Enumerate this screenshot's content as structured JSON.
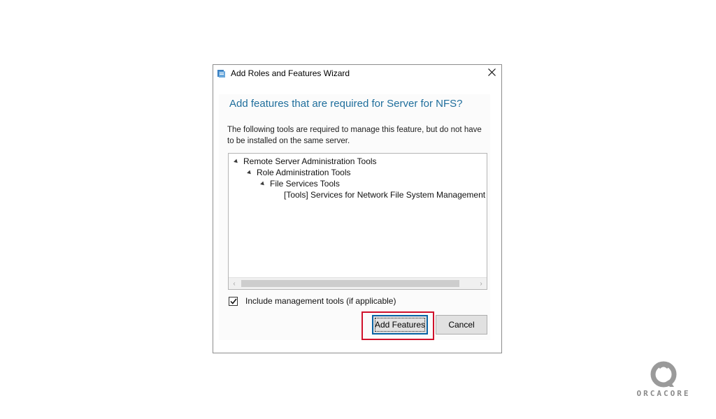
{
  "dialog": {
    "title": "Add Roles and Features Wizard",
    "heading": "Add features that are required for Server for NFS?",
    "description": "The following tools are required to manage this feature, but do not have to be installed on the same server."
  },
  "tree": {
    "items": [
      {
        "label": "Remote Server Administration Tools",
        "level": 0,
        "expanded": true
      },
      {
        "label": "Role Administration Tools",
        "level": 1,
        "expanded": true
      },
      {
        "label": "File Services Tools",
        "level": 2,
        "expanded": true
      },
      {
        "label": "[Tools] Services for Network File System Management T",
        "level": 3,
        "expanded": false
      }
    ]
  },
  "options": {
    "include_tools_label": "Include management tools (if applicable)",
    "include_tools_checked": true
  },
  "buttons": {
    "add_features": "Add Features",
    "cancel": "Cancel"
  },
  "watermark": {
    "text": "ORCACORE"
  },
  "colors": {
    "heading": "#1f6e9c",
    "highlight": "#d0112b"
  }
}
